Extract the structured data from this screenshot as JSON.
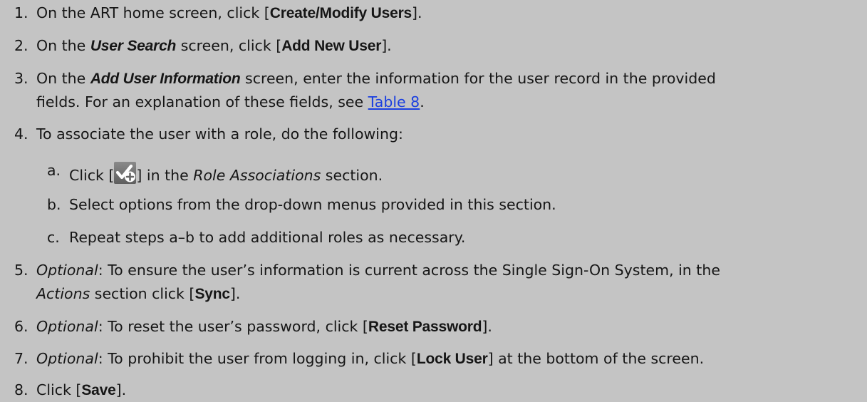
{
  "steps": [
    {
      "num": "1.",
      "a": "On the ART home screen, click [",
      "b": "Create/Modify Users",
      "c": "]."
    },
    {
      "num": "2.",
      "a": "On the ",
      "b": "User Search",
      "c": " screen, click [",
      "d": "Add New User",
      "e": "]."
    },
    {
      "num": "3.",
      "a": "On the ",
      "b": "Add User Information",
      "c": " screen, enter the information for the user record in the provided",
      "line2a": "fields. For an explanation of these fields, see ",
      "link": "Table 8",
      "line2b": "."
    },
    {
      "num": "4.",
      "a": "To associate the user with a role, do the following:"
    },
    {
      "num": "5.",
      "a": "Optional",
      "b": ": To ensure the user’s information is current across the Single Sign-On System, in the",
      "line2a": "Actions",
      "line2b": " section click [",
      "line2c": "Sync",
      "line2d": "]."
    },
    {
      "num": "6.",
      "a": "Optional",
      "b": ": To reset the user’s password, click [",
      "c": "Reset Password",
      "d": "]."
    },
    {
      "num": "7.",
      "a": "Optional",
      "b": ": To prohibit the user from logging in, click [",
      "c": "Lock User",
      "d": "] at the bottom of the screen."
    },
    {
      "num": "8.",
      "a": "Click [",
      "b": "Save",
      "c": "]."
    }
  ],
  "substeps": [
    {
      "num": "a.",
      "a": "Click [",
      "icon": "add-role-icon",
      "b": "] in the ",
      "c": "Role Associations",
      "d": " section."
    },
    {
      "num": "b.",
      "a": "Select options from the drop-down menus provided in this section."
    },
    {
      "num": "c.",
      "a": "Repeat steps a–b to add additional roles as necessary."
    }
  ],
  "colors": {
    "background": "#c4c4c4",
    "text": "#161616",
    "link": "#1a3fe0"
  }
}
